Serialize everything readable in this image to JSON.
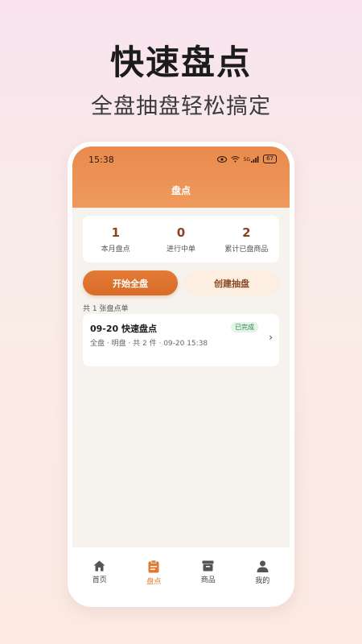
{
  "hero": {
    "title": "快速盘点",
    "subtitle": "全盘抽盘轻松搞定"
  },
  "status_bar": {
    "time": "15:38",
    "network": "5G",
    "battery": "67"
  },
  "app_bar": {
    "title": "盘点"
  },
  "stats": [
    {
      "value": "1",
      "label": "本月盘点"
    },
    {
      "value": "0",
      "label": "进行中单"
    },
    {
      "value": "2",
      "label": "累计已盘商品"
    }
  ],
  "actions": {
    "start_full": "开始全盘",
    "create_sample": "创建抽盘"
  },
  "list": {
    "count_label": "共 1 张盘点单",
    "items": [
      {
        "title": "09-20 快速盘点",
        "status": "已完成",
        "meta": "全盘 · 明盘 · 共 2 件 · 09-20 15:38"
      }
    ]
  },
  "tabs": [
    {
      "label": "首页",
      "icon": "home-icon"
    },
    {
      "label": "盘点",
      "icon": "clipboard-icon",
      "active": true
    },
    {
      "label": "商品",
      "icon": "archive-icon"
    },
    {
      "label": "我的",
      "icon": "user-icon"
    }
  ],
  "colors": {
    "accent": "#e07a34",
    "header": "#ec914f",
    "badge_text": "#2f8a4c"
  }
}
